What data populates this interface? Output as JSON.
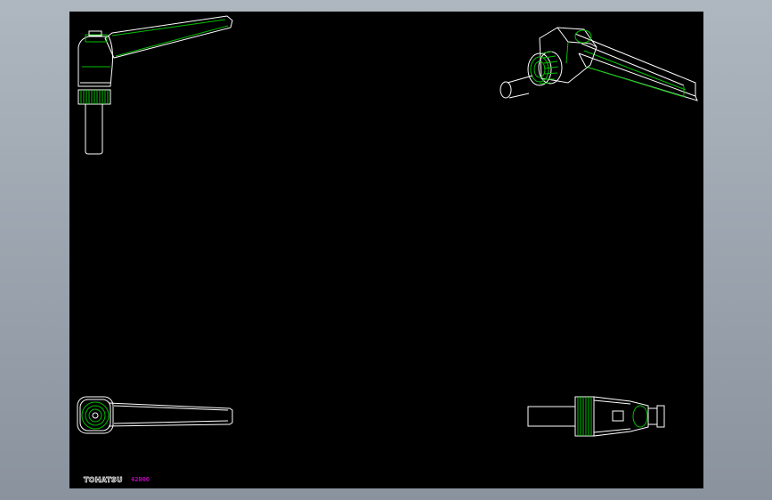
{
  "title_block": {
    "logo_text": "TOHATSU",
    "part_code": "42806"
  },
  "colors": {
    "background": "#9aa3ad",
    "sheet": "#000000",
    "outline": "#ffffff",
    "detail": "#00c000",
    "code_text": "#ff00ff"
  },
  "views": [
    "side-view",
    "isometric-view",
    "top-view",
    "end-view"
  ]
}
